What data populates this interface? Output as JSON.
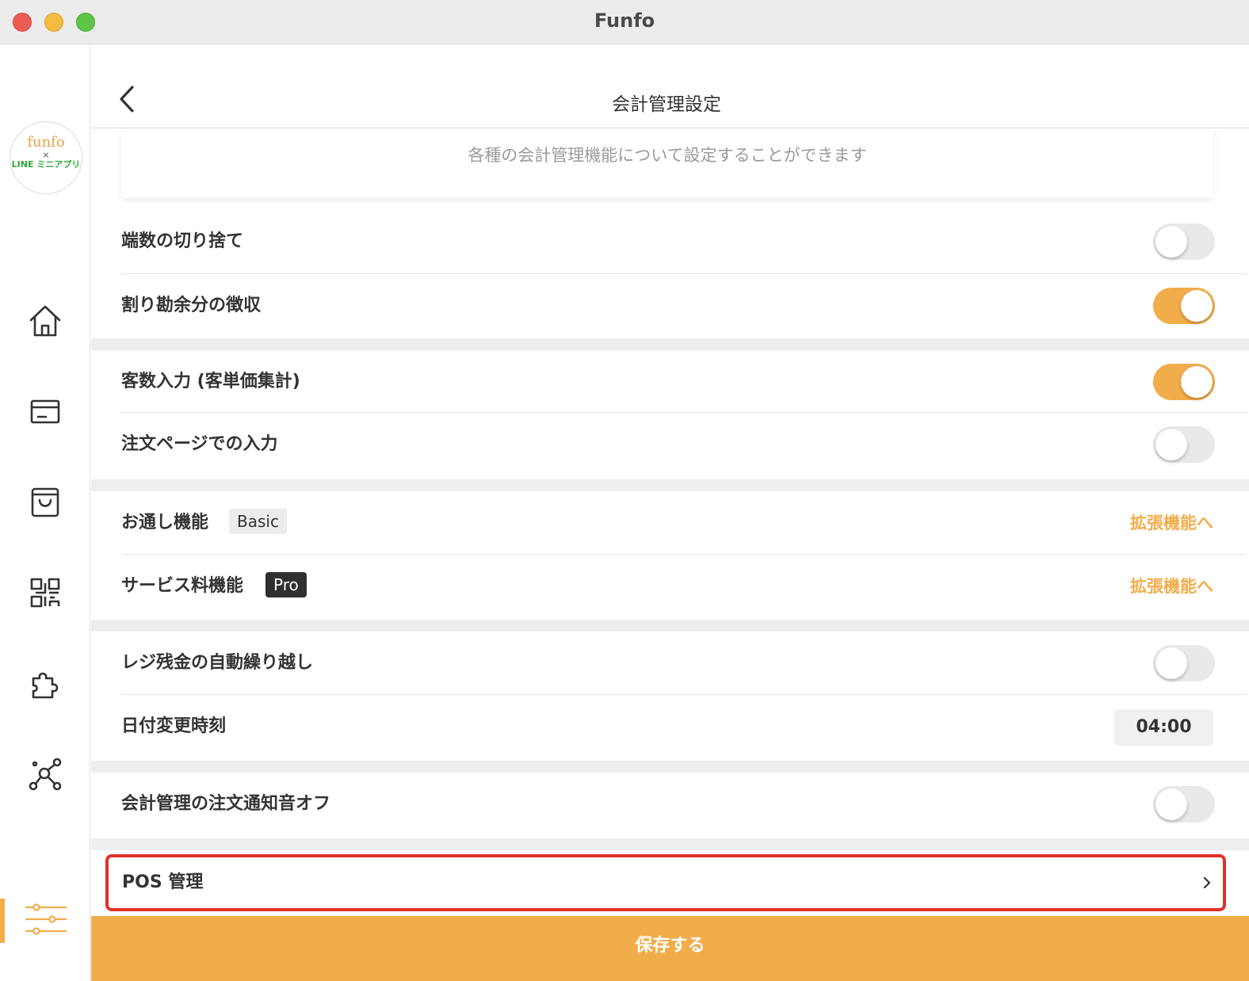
{
  "window": {
    "title": "Funfo"
  },
  "logo": {
    "brand": "funfo",
    "cross": "×",
    "partner": "LINE ミニアプリ"
  },
  "sidebar": {
    "items": [
      {
        "icon": "home-icon"
      },
      {
        "icon": "card-icon"
      },
      {
        "icon": "shopping-bag-icon"
      },
      {
        "icon": "qr-code-icon"
      },
      {
        "icon": "puzzle-icon"
      },
      {
        "icon": "network-icon"
      },
      {
        "icon": "settings-sliders-icon",
        "active": true
      }
    ],
    "accent_color": "#f2ad4b"
  },
  "header": {
    "title": "会計管理設定"
  },
  "description": "各種の会計管理機能について設定することができます",
  "settings": {
    "rounding": {
      "label": "端数の切り捨て",
      "enabled": false
    },
    "split_remainder": {
      "label": "割り勘余分の徴収",
      "enabled": true
    },
    "guest_count": {
      "label": "客数入力 (客単価集計)",
      "enabled": true
    },
    "order_page_input": {
      "label": "注文ページでの入力",
      "enabled": false
    },
    "otoshi": {
      "label": "お通し機能",
      "badge": "Basic",
      "link": "拡張機能へ"
    },
    "service_charge": {
      "label": "サービス料機能",
      "badge": "Pro",
      "link": "拡張機能へ"
    },
    "carry_over": {
      "label": "レジ残金の自動繰り越し",
      "enabled": false
    },
    "date_change": {
      "label": "日付変更時刻",
      "value": "04:00"
    },
    "notification_off": {
      "label": "会計管理の注文通知音オフ",
      "enabled": false
    },
    "pos": {
      "label": "POS 管理"
    }
  },
  "footer": {
    "save_label": "保存する"
  }
}
